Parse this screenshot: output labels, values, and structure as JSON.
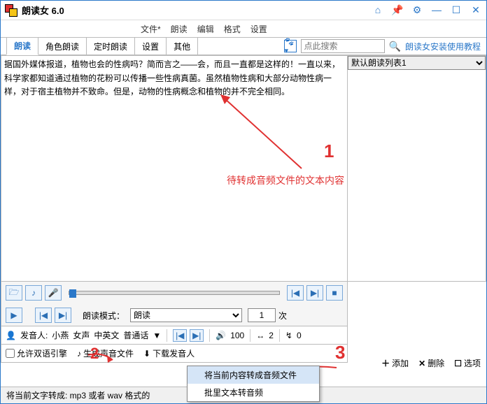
{
  "window": {
    "title": "朗读女  6.0"
  },
  "menu": {
    "file": "文件*",
    "read": "朗读",
    "edit": "编辑",
    "format": "格式",
    "settings": "设置"
  },
  "tabs": {
    "t1": "朗读",
    "t2": "角色朗读",
    "t3": "定时朗读",
    "t4": "设置",
    "t5": "其他"
  },
  "search": {
    "placeholder": "点此搜索"
  },
  "help_link": "朗读女安装使用教程",
  "text_content": "据国外媒体报道，植物也会的性病吗？简而言之——会，而且一直都是这样的！一直以来，科学家都知道通过植物的花粉可以传播一些性病真菌。虽然植物性病和大部分动物性病一样，对于宿主植物并不致命。但是，动物的性病概念和植物的并不完全相同。",
  "side_select": "默认朗读列表1",
  "mode": {
    "label": "朗读模式：",
    "value": "朗读",
    "times": "1",
    "unit": "次"
  },
  "voice": {
    "prefix": "发音人:",
    "name": "小燕",
    "gender": "女声",
    "lang": "中英文",
    "dialect": "普通话",
    "volume": "100",
    "speed": "2",
    "pitch": "0"
  },
  "gen": {
    "dual": "允许双语引擎",
    "gen_audio": "生成声音文件",
    "download": "下载发音人"
  },
  "context_menu": {
    "i1": "将当前内容转成音频文件",
    "i2": "批里文本转音频"
  },
  "status": "将当前文字转成: mp3 或者 wav 格式的",
  "bottom": {
    "add": "添加",
    "del": "删除",
    "opts": "选项"
  },
  "annotations": {
    "a1": "待转成音频文件的文本内容",
    "n1": "1",
    "n2": "2",
    "n3": "3"
  }
}
